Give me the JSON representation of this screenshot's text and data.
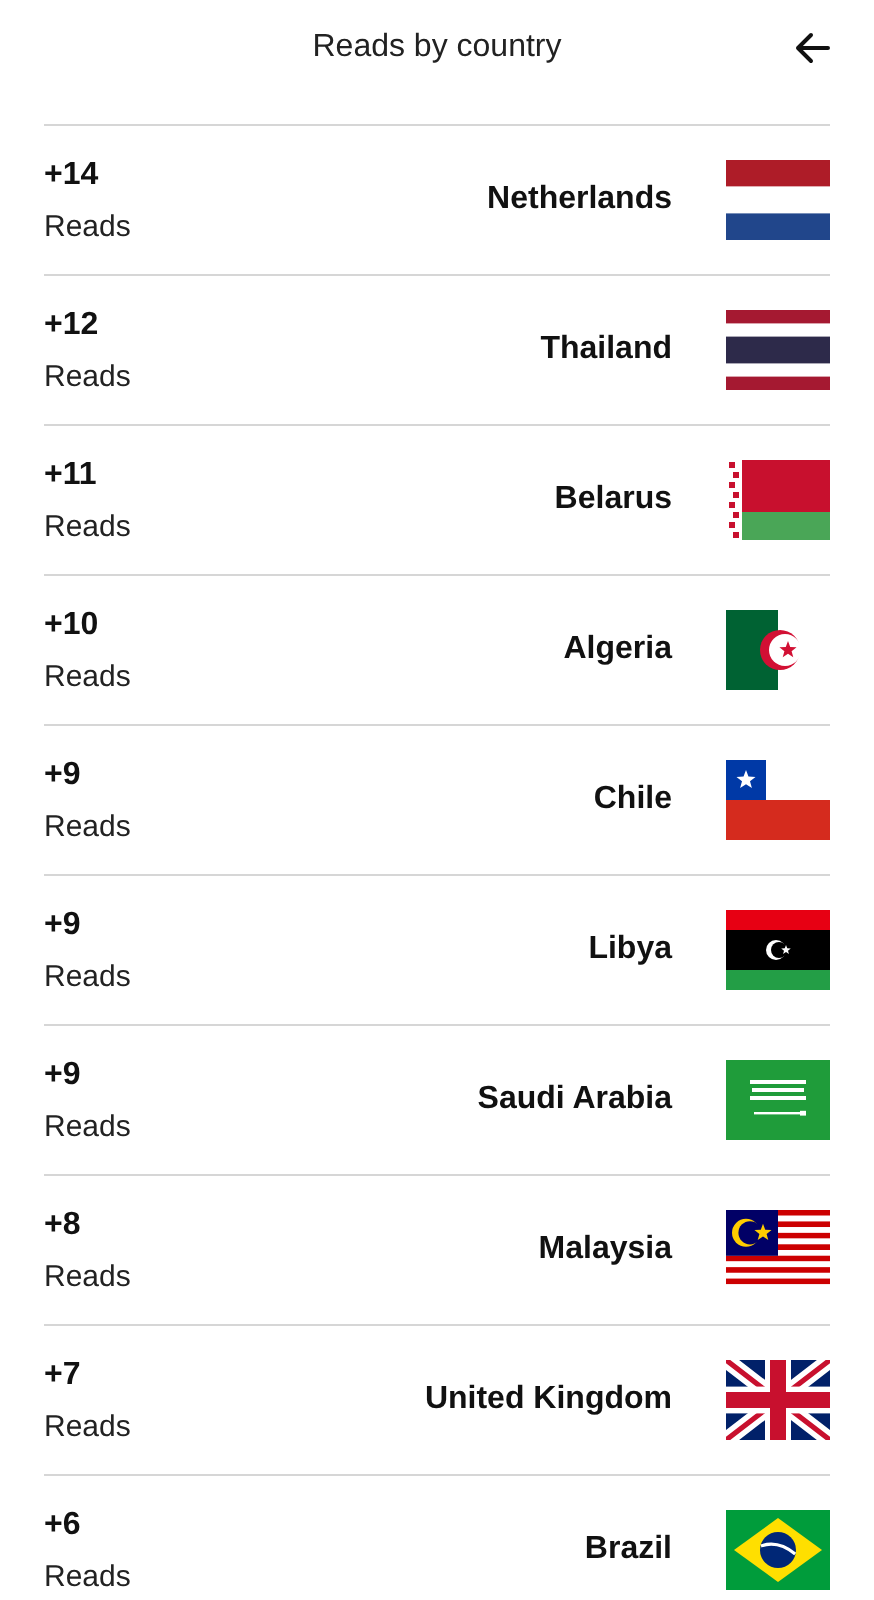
{
  "header": {
    "title": "Reads by country"
  },
  "rows": [
    {
      "count": "+14",
      "unit": "Reads",
      "country": "Netherlands"
    },
    {
      "count": "+12",
      "unit": "Reads",
      "country": "Thailand"
    },
    {
      "count": "+11",
      "unit": "Reads",
      "country": "Belarus"
    },
    {
      "count": "+10",
      "unit": "Reads",
      "country": "Algeria"
    },
    {
      "count": "+9",
      "unit": "Reads",
      "country": "Chile"
    },
    {
      "count": "+9",
      "unit": "Reads",
      "country": "Libya"
    },
    {
      "count": "+9",
      "unit": "Reads",
      "country": "Saudi Arabia"
    },
    {
      "count": "+8",
      "unit": "Reads",
      "country": "Malaysia"
    },
    {
      "count": "+7",
      "unit": "Reads",
      "country": "United Kingdom"
    },
    {
      "count": "+6",
      "unit": "Reads",
      "country": "Brazil"
    }
  ]
}
